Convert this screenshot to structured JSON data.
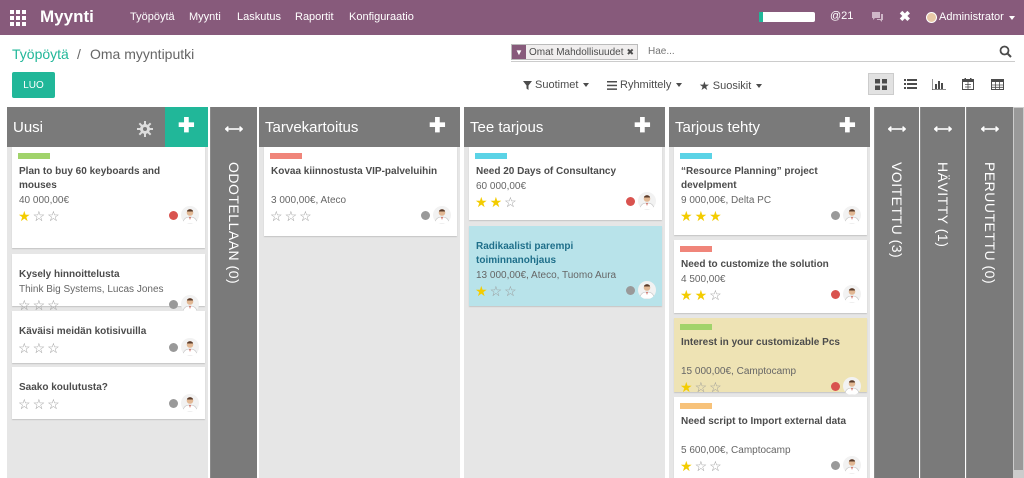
{
  "nav": {
    "app": "Myynti",
    "menus": [
      "Työpöytä",
      "Myynti",
      "Laskutus",
      "Raportit",
      "Konfiguraatio"
    ],
    "mentions": "@21",
    "user": "Administrator",
    "tool_glyph": "✖"
  },
  "breadcrumb": {
    "root": "Työpöytä",
    "separator": "/",
    "current": "Oma myyntiputki"
  },
  "search": {
    "facet": "Omat Mahdollisuudet",
    "placeholder": "Hae..."
  },
  "toolbar": {
    "create": "LUO",
    "filters": "Suotimet",
    "groupby": "Ryhmittely",
    "favorites": "Suosikit"
  },
  "columns": [
    {
      "title": "Uusi",
      "cards": [
        {
          "title": "Plan to buy 60 keyboards and mouses",
          "sub": "40 000,00€",
          "stars": 1,
          "tag": "#a1d36b",
          "dot": "#d9534f"
        },
        {
          "title": "Kysely hinnoittelusta",
          "sub": "Think Big Systems, Lucas Jones",
          "stars": 0,
          "tag": "",
          "dot": "#999999"
        },
        {
          "title": "Käväisi meidän kotisivuilla",
          "sub": "",
          "stars": 0,
          "tag": "",
          "dot": "#999999"
        },
        {
          "title": "Saako koulutusta?",
          "sub": "",
          "stars": 0,
          "tag": "",
          "dot": "#999999"
        }
      ]
    },
    {
      "title": "ODOTELLAAN (0)",
      "folded": true
    },
    {
      "title": "Tarvekartoitus",
      "cards": [
        {
          "title": "Kovaa kiinnostusta VIP-palveluihin",
          "sub": "3 000,00€, Ateco",
          "stars": 0,
          "tag": "#f0857a",
          "dot": "#999999"
        }
      ]
    },
    {
      "title": "Tee tarjous",
      "cards": [
        {
          "title": "Need 20 Days of Consultancy",
          "sub": "60 000,00€",
          "stars": 2,
          "tag": "#5bd3e6",
          "dot": "#d9534f"
        },
        {
          "title": "Radikaalisti parempi toiminnanohjaus",
          "sub": "13 000,00€, Ateco, Tuomo Aura",
          "stars": 1,
          "tag": "",
          "dot": "#999999",
          "highlight": true
        }
      ]
    },
    {
      "title": "Tarjous tehty",
      "cards": [
        {
          "title": "“Resource Planning” project develpment",
          "sub": "9 000,00€, Delta PC",
          "stars": 3,
          "tag": "#5bd3e6",
          "dot": "#999999"
        },
        {
          "title": "Need to customize the solution",
          "sub": "4 500,00€",
          "stars": 2,
          "tag": "#f0857a",
          "dot": "#d9534f"
        },
        {
          "title": "Interest in your customizable Pcs",
          "sub": "15 000,00€, Camptocamp",
          "stars": 1,
          "tag": "#a1d36b",
          "dot": "#d9534f",
          "warning": true
        },
        {
          "title": "Need script to Import external data",
          "sub": "5 600,00€, Camptocamp",
          "stars": 1,
          "tag": "#f7c27a",
          "dot": "#999999"
        }
      ]
    },
    {
      "title": "VOITETTU (3)",
      "folded": true
    },
    {
      "title": "HÄVITTY (1)",
      "folded": true
    },
    {
      "title": "PERUUTETTU (0)",
      "folded": true
    }
  ],
  "colors": {
    "brand": "#875a7b",
    "accent": "#21b799",
    "column_bg": "#e6e6e6",
    "column_header": "#7a7a7a",
    "folded_bg": "#7a7a7a",
    "highlight_card": "#b8e3ea",
    "warning_card": "#eee3b4"
  }
}
